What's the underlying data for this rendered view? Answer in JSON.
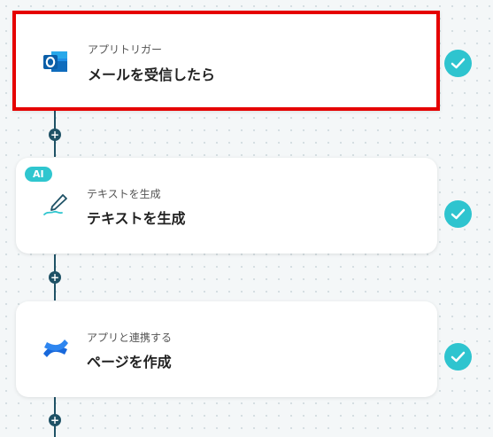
{
  "steps": [
    {
      "category": "アプリトリガー",
      "title": "メールを受信したら",
      "icon": "outlook-icon"
    },
    {
      "category": "テキストを生成",
      "title": "テキストを生成",
      "icon": "pen-icon",
      "badge": "AI"
    },
    {
      "category": "アプリと連携する",
      "title": "ページを作成",
      "icon": "confluence-icon"
    }
  ],
  "add_button": "+",
  "colors": {
    "selected_border": "#e50000",
    "check": "#2ec4cf",
    "connector": "#1f5266",
    "ai_badge": "#2fc6cf"
  }
}
